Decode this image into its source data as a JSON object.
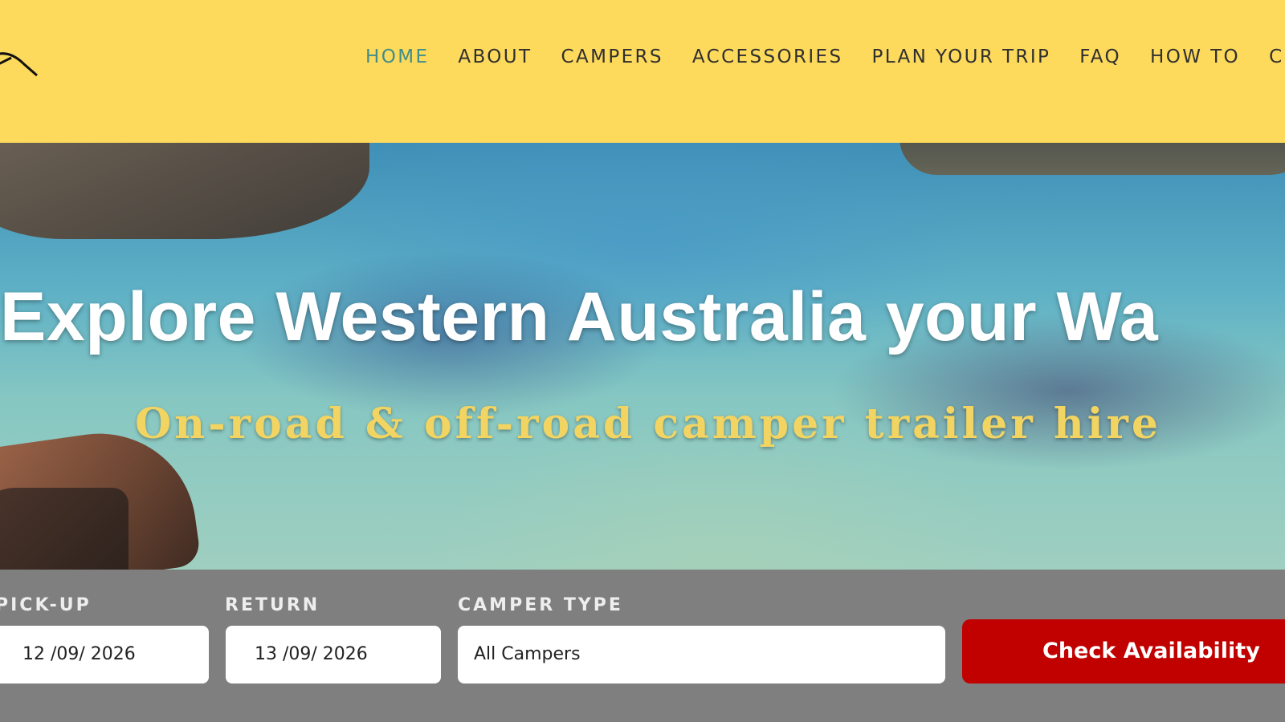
{
  "nav": {
    "items": [
      {
        "label": "HOME",
        "active": true
      },
      {
        "label": "ABOUT"
      },
      {
        "label": "CAMPERS"
      },
      {
        "label": "ACCESSORIES"
      },
      {
        "label": "PLAN YOUR TRIP"
      },
      {
        "label": "FAQ"
      },
      {
        "label": "HOW TO"
      },
      {
        "label": "C"
      }
    ]
  },
  "hero": {
    "title": "Explore Western Australia your Wa",
    "subtitle": "On-road & off-road camper trailer hire"
  },
  "booking": {
    "pickup_label": "PICK-UP",
    "pickup_value": "12 /09/ 2026",
    "return_label": "RETURN",
    "return_value": "13 /09/ 2026",
    "camper_type_label": "CAMPER TYPE",
    "camper_type_value": "All Campers",
    "check_button": "Check Availability"
  },
  "colors": {
    "header_bg": "#fdd95c",
    "nav_active": "#3f8e8a",
    "booking_bg": "#7f7f7f",
    "button_bg": "#c10000",
    "subtitle": "#f2d462"
  }
}
